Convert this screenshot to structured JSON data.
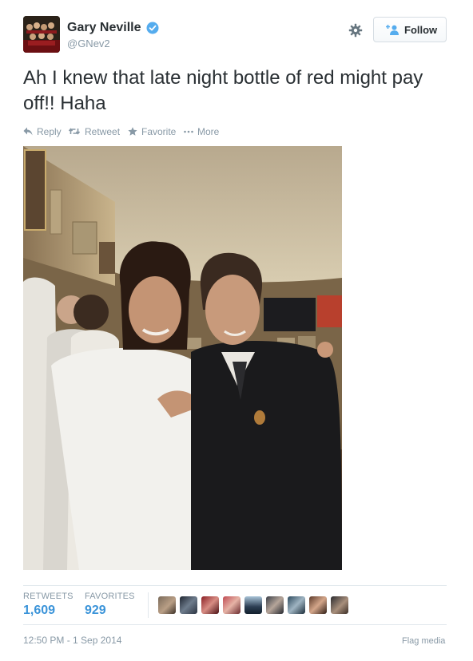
{
  "user": {
    "name": "Gary Neville",
    "handle": "@GNev2",
    "avatar_icon": "team-photo-avatar",
    "verified_icon": "verified-badge-icon"
  },
  "header": {
    "settings_icon": "gear-icon",
    "follow_label": "Follow",
    "follow_icon": "add-user-icon"
  },
  "tweet": {
    "text": "Ah I knew that late night bottle of red might pay off!! Haha"
  },
  "actions": {
    "reply": "Reply",
    "retweet": "Retweet",
    "favorite": "Favorite",
    "more": "More"
  },
  "stats": {
    "retweets_label": "RETWEETS",
    "retweets_value": "1,609",
    "favorites_label": "FAVORITES",
    "favorites_value": "929",
    "favoriters_count_shown": 9
  },
  "footer": {
    "timestamp": "12:50 PM - 1 Sep 2014",
    "flag_label": "Flag media"
  },
  "colors": {
    "link_blue": "#3b94d9",
    "muted_gray": "#8899a6",
    "text_dark": "#292f33",
    "verified_blue": "#55acee"
  }
}
